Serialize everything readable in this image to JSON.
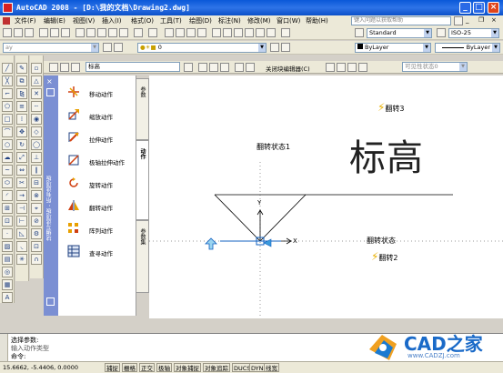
{
  "window": {
    "title": "AutoCAD 2008 - [D:\\我的文档\\Drawing2.dwg]"
  },
  "menu": [
    "文件(F)",
    "编辑(E)",
    "视图(V)",
    "插入(I)",
    "格式(O)",
    "工具(T)",
    "绘图(D)",
    "标注(N)",
    "修改(M)",
    "窗口(W)",
    "帮助(H)"
  ],
  "help_search": {
    "placeholder": "键入问题以获取帮助"
  },
  "styles": {
    "text_style": "Standard",
    "dim_style": "ISO-25"
  },
  "layers": {
    "current": "0",
    "filter": "ay"
  },
  "properties": {
    "color": "ByLayer",
    "linetype": "ByLayer"
  },
  "block_editor": {
    "block_name": "标高",
    "close_label": "关闭块编辑器(C)",
    "visibility_state": "可见性状态0"
  },
  "palette": {
    "title": "块编写选项板 - 所有选项板",
    "items": [
      {
        "label": "移动动作",
        "icon": "move-action-icon"
      },
      {
        "label": "缩放动作",
        "icon": "scale-action-icon"
      },
      {
        "label": "拉伸动作",
        "icon": "stretch-action-icon"
      },
      {
        "label": "极轴拉伸动作",
        "icon": "polar-stretch-action-icon"
      },
      {
        "label": "旋转动作",
        "icon": "rotate-action-icon"
      },
      {
        "label": "翻转动作",
        "icon": "flip-action-icon"
      },
      {
        "label": "阵列动作",
        "icon": "array-action-icon"
      },
      {
        "label": "查寻动作",
        "icon": "lookup-action-icon"
      }
    ],
    "tabs": [
      "参数",
      "动作",
      "参数集"
    ]
  },
  "drawing": {
    "flip_state_label": "翻转状态1",
    "flip_state_label2": "翻转状态",
    "flip3": "翻转3",
    "flip2": "翻转2",
    "elevation_text": "标高",
    "y_axis": "Y",
    "x_axis": "X"
  },
  "command": {
    "line1": "选择参数:",
    "line2": "输入动作类型",
    "prompt": "命令:"
  },
  "status": {
    "coords": "15.6662, -5.4406, 0.0000",
    "buttons": [
      "捕捉",
      "栅格",
      "正交",
      "极轴",
      "对象捕捉",
      "对象追踪",
      "DUCS",
      "DYN",
      "线宽"
    ]
  },
  "watermark": {
    "text": "CAD之家",
    "url": "www.CADZJ.com"
  }
}
